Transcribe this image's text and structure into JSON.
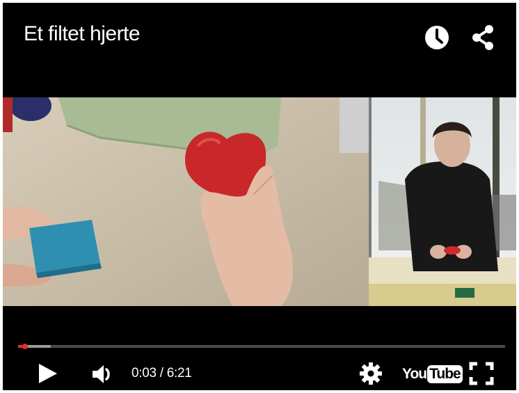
{
  "video": {
    "title": "Et filtet hjerte"
  },
  "top_controls": {
    "watch_later_icon": "clock-icon",
    "share_icon": "share-icon"
  },
  "playback": {
    "current_time": "0:03",
    "duration": "6:21",
    "time_display": "0:03 / 6:21",
    "played_fraction": 0.008,
    "buffered_fraction": 0.067
  },
  "controls": {
    "play_icon": "play-icon",
    "volume_icon": "volume-icon",
    "settings_icon": "gear-icon",
    "fullscreen_icon": "fullscreen-icon"
  },
  "brand": {
    "logo_you": "You",
    "logo_tube": "Tube"
  },
  "colors": {
    "accent": "#e52d27",
    "player_bg": "#000000",
    "text": "#ffffff"
  }
}
